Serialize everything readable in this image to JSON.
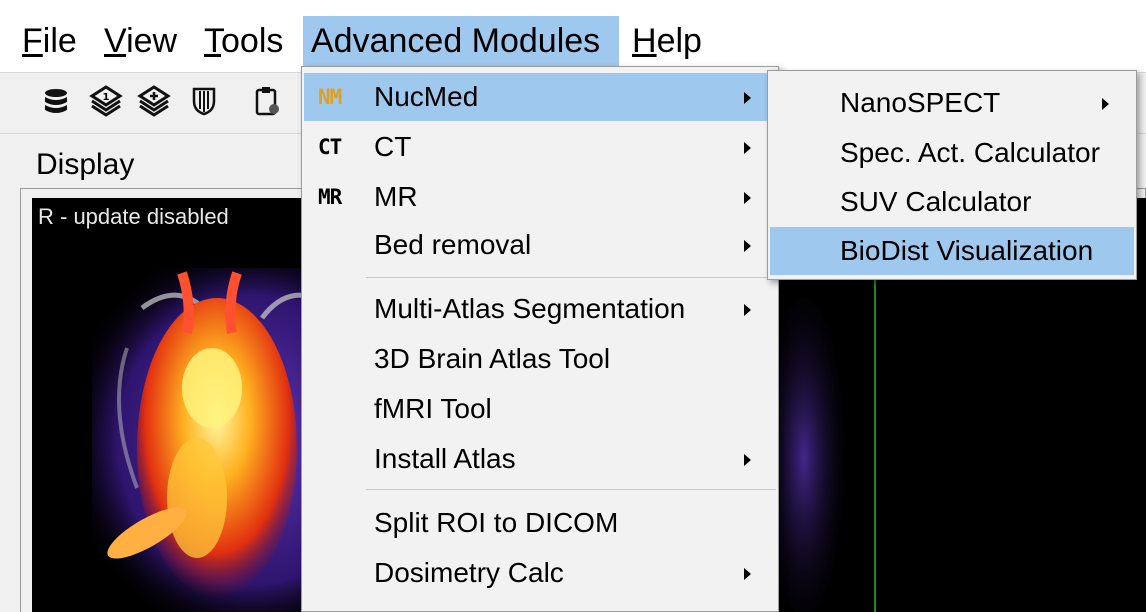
{
  "menubar": {
    "items": [
      {
        "label": "File",
        "mnemonic": "F",
        "rest": "ile"
      },
      {
        "label": "View",
        "mnemonic": "V",
        "rest": "iew"
      },
      {
        "label": "Tools",
        "mnemonic": "T",
        "rest": "ools"
      },
      {
        "label": "Advanced Modules",
        "mnemonic": "",
        "rest": "Advanced Modules"
      },
      {
        "label": "Help",
        "mnemonic": "H",
        "rest": "elp"
      }
    ],
    "active": "Advanced Modules"
  },
  "toolbar": {
    "icons": [
      "database-stack-icon",
      "layers-1-icon",
      "layers-add-icon",
      "shield-mask-icon",
      "clipboard-gear-icon"
    ]
  },
  "display": {
    "group_title": "Display",
    "left_view_label": "R - update disabled"
  },
  "advanced_menu": {
    "items": [
      {
        "icon_text": "NM",
        "label": "NucMed",
        "has_submenu": true,
        "highlighted": true
      },
      {
        "icon_text": "CT",
        "label": "CT",
        "has_submenu": true
      },
      {
        "icon_text": "MR",
        "label": "MR",
        "has_submenu": true
      },
      {
        "icon_text": "",
        "label": "Bed removal",
        "has_submenu": true
      },
      {
        "icon_text": "",
        "label": "Multi-Atlas Segmentation",
        "has_submenu": true
      },
      {
        "icon_text": "",
        "label": "3D Brain Atlas Tool",
        "has_submenu": false
      },
      {
        "icon_text": "",
        "label": "fMRI Tool",
        "has_submenu": false
      },
      {
        "icon_text": "",
        "label": "Install Atlas",
        "has_submenu": true
      },
      {
        "icon_text": "",
        "label": "Split ROI to DICOM",
        "has_submenu": false
      },
      {
        "icon_text": "",
        "label": "Dosimetry Calc",
        "has_submenu": true
      }
    ]
  },
  "nucmed_submenu": {
    "items": [
      {
        "label": "NanoSPECT",
        "has_submenu": true
      },
      {
        "label": "Spec. Act. Calculator",
        "has_submenu": false
      },
      {
        "label": "SUV Calculator",
        "has_submenu": false
      },
      {
        "label": "BioDist Visualization",
        "has_submenu": false,
        "highlighted": true
      }
    ]
  },
  "colors": {
    "highlight": "#9fc8ee",
    "nm_icon": "#e0a020",
    "crosshair": "#1b8a1b"
  }
}
